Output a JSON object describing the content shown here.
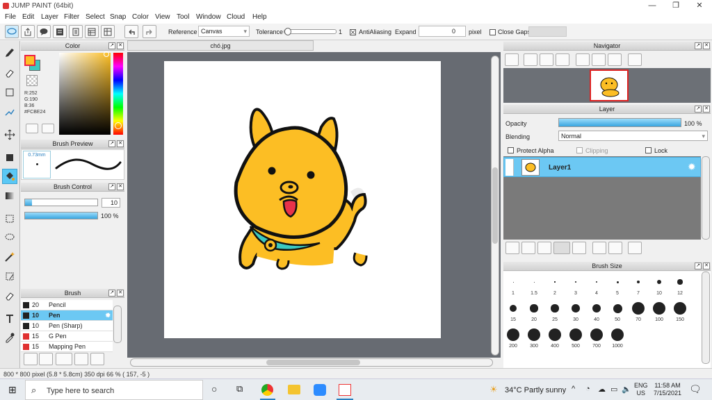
{
  "window": {
    "title": "JUMP PAINT (64bit)",
    "minimize": "—",
    "maximize": "❐",
    "close": "✕"
  },
  "menu": [
    "File",
    "Edit",
    "Layer",
    "Filter",
    "Select",
    "Snap",
    "Color",
    "View",
    "Tool",
    "Window",
    "Cloud",
    "Help"
  ],
  "toolbar": {
    "reference_label": "Reference",
    "reference_value": "Canvas",
    "tolerance_label": "Tolerance",
    "tolerance_value": "1",
    "antialiasing_label": "AntiAliasing",
    "expand_label": "Expand",
    "expand_value": "0",
    "expand_unit": "pixel",
    "close_gaps_label": "Close Gaps"
  },
  "color_panel": {
    "title": "Color",
    "r": "R:252",
    "g": "G:190",
    "b": "B:36",
    "hex": "#FCBE24",
    "primary": "#FCBE24",
    "secondary": "#3cc8c0"
  },
  "brush_preview": {
    "title": "Brush Preview",
    "size": "0.73mm"
  },
  "brush_control": {
    "title": "Brush Control",
    "size_value": "10",
    "opacity_value": "100 %",
    "size_fraction": 0.1,
    "opacity_fraction": 1.0
  },
  "brush_panel": {
    "title": "Brush",
    "items": [
      {
        "size": "20",
        "name": "Pencil",
        "color": "#222222"
      },
      {
        "size": "10",
        "name": "Pen",
        "color": "#222222"
      },
      {
        "size": "10",
        "name": "Pen (Sharp)",
        "color": "#222222"
      },
      {
        "size": "15",
        "name": "G Pen",
        "color": "#e03030"
      },
      {
        "size": "15",
        "name": "Mapping Pen",
        "color": "#e03030"
      }
    ]
  },
  "document": {
    "tab": "chó.jpg"
  },
  "navigator": {
    "title": "Navigator"
  },
  "layer_panel": {
    "title": "Layer",
    "opacity_label": "Opacity",
    "opacity_value": "100 %",
    "opacity_fraction": 1.0,
    "blending_label": "Blending",
    "blending_value": "Normal",
    "protect_alpha": "Protect Alpha",
    "clipping": "Clipping",
    "lock": "Lock",
    "layer_name": "Layer1"
  },
  "brush_size": {
    "title": "Brush Size",
    "sizes": [
      "1",
      "1.5",
      "2",
      "3",
      "4",
      "5",
      "7",
      "10",
      "12",
      "15",
      "20",
      "25",
      "30",
      "40",
      "50",
      "70",
      "100",
      "150",
      "200",
      "300",
      "400",
      "500",
      "700",
      "1000"
    ]
  },
  "status": {
    "text": "800 * 800 pixel  (5.8 * 5.8cm)  350 dpi  66 %  ( 157, -5 )"
  },
  "taskbar": {
    "search_placeholder": "Type here to search",
    "weather": "34°C  Partly sunny",
    "lang1": "ENG",
    "lang2": "US",
    "time": "11:58 AM",
    "date": "7/15/2021"
  }
}
